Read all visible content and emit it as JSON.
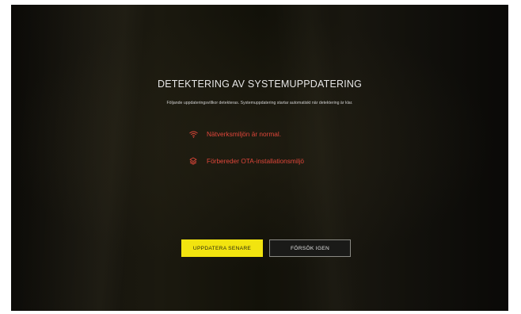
{
  "dialog": {
    "title": "DETEKTERING AV SYSTEMUPPDATERING",
    "subtitle": "Följande uppdateringsvillkor detekteras. Systemuppdatering startar automatiskt när detektering är klar."
  },
  "checks": [
    {
      "icon": "wifi-icon",
      "label": "Nätverksmiljön är normal."
    },
    {
      "icon": "layers-icon",
      "label": "Förbereder OTA-installationsmiljö"
    }
  ],
  "buttons": {
    "later_label": "UPPDATERA SENARE",
    "retry_label": "FÖRSÖK IGEN"
  },
  "colors": {
    "accent": "#f2e40f",
    "status": "#e0463a",
    "background": "#121109"
  }
}
